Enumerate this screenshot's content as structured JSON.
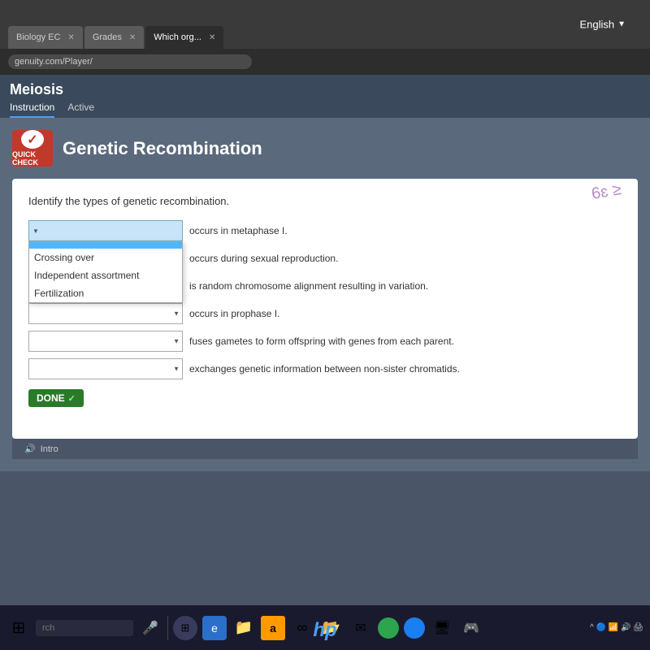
{
  "browser": {
    "tabs": [
      {
        "label": "Biology EC",
        "active": false
      },
      {
        "label": "Grades",
        "active": false
      },
      {
        "label": "Which org...",
        "active": true
      }
    ],
    "address": "genuity.com/Player/",
    "lang": "English"
  },
  "page": {
    "title": "Meiosis",
    "nav": [
      {
        "label": "Instruction",
        "active": true
      },
      {
        "label": "Active",
        "active": false
      }
    ]
  },
  "card": {
    "badge_label": "QUICK CHECK",
    "title": "Genetic Recombination",
    "question": "Identify the types of genetic recombination.",
    "dropdown_options": [
      {
        "value": "",
        "label": ""
      },
      {
        "value": "crossing_over",
        "label": "Crossing over"
      },
      {
        "value": "independent_assortment",
        "label": "Independent assortment"
      },
      {
        "value": "fertilization",
        "label": "Fertilization"
      }
    ],
    "matches": [
      {
        "dropdown_open": true,
        "selected_value": "",
        "description": "occurs in metaphase I."
      },
      {
        "dropdown_open": false,
        "selected_value": "",
        "description": "occurs during sexual reproduction."
      },
      {
        "dropdown_open": false,
        "selected_value": "",
        "description": "is random chromosome alignment resulting in variation."
      },
      {
        "dropdown_open": false,
        "selected_value": "",
        "description": "occurs in prophase I."
      },
      {
        "dropdown_open": false,
        "selected_value": "",
        "description": "fuses gametes to form offspring with genes from each parent."
      },
      {
        "dropdown_open": false,
        "selected_value": "",
        "description": "exchanges genetic information between non-sister chromatids."
      }
    ],
    "done_button": "DONE"
  },
  "footer": {
    "intro_label": "Intro"
  },
  "taskbar": {
    "search_placeholder": "rch",
    "icons": [
      "⊞",
      "🔍",
      "🌐",
      "📋",
      "🔵",
      "📁",
      "a",
      "∞",
      "📁",
      "✉",
      "🔄",
      "💻"
    ],
    "hp_logo": "hp"
  }
}
